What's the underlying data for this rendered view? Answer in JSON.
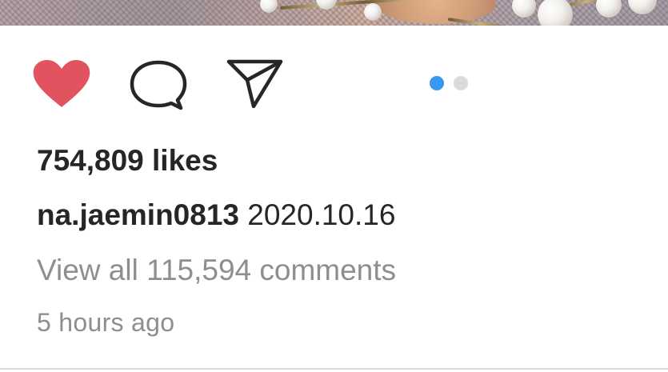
{
  "post": {
    "image": {
      "alt": ""
    },
    "actions": {
      "like_icon": "heart-filled-icon",
      "comment_icon": "comment-bubble-icon",
      "share_icon": "paper-plane-icon",
      "liked": true
    },
    "carousel": {
      "count": 2,
      "active_index": 0
    },
    "likes_text": "754,809 likes",
    "caption": {
      "username": "na.jaemin0813",
      "text": "2020.10.16"
    },
    "view_comments_text": "View all 115,594 comments",
    "timestamp": "5 hours ago"
  },
  "colors": {
    "like_red": "#e0535f",
    "icon_stroke": "#262626",
    "dot_active": "#3897f0",
    "dot_inactive": "#dbdbdb",
    "secondary_text": "#8e8e8e",
    "primary_text": "#262626"
  }
}
